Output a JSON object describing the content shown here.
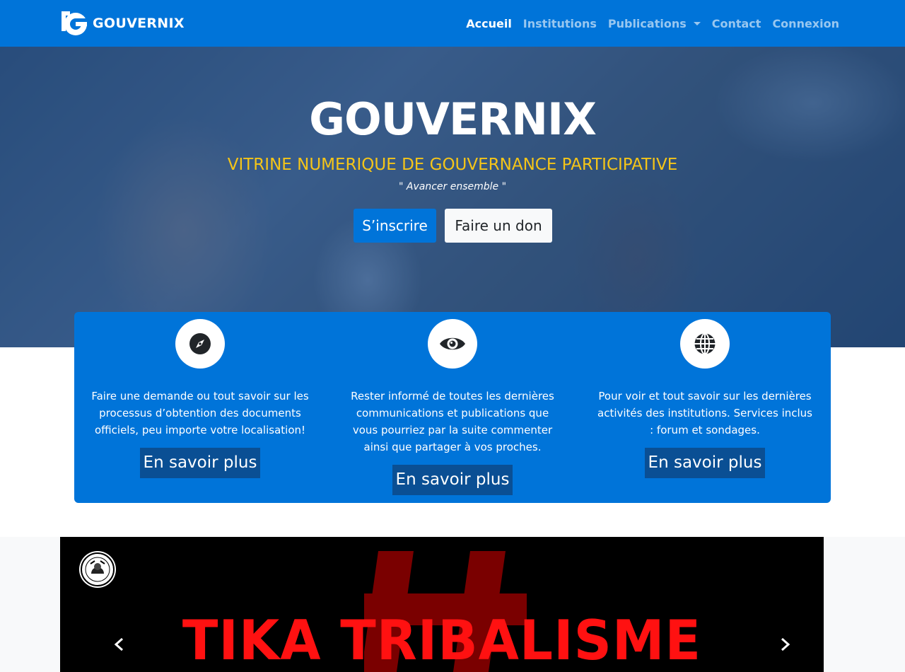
{
  "navbar": {
    "brand": "GOUVERNIX",
    "links": [
      {
        "label": "Accueil",
        "active": true
      },
      {
        "label": "Institutions"
      },
      {
        "label": "Publications",
        "dropdown": true
      },
      {
        "label": "Contact"
      },
      {
        "label": "Connexion"
      }
    ],
    "color": "#0074d9"
  },
  "hero": {
    "title": "GOUVERNIX",
    "subtitle": "VITRINE NUMERIQUE DE GOUVERNANCE PARTICIPATIVE",
    "quote": "\" Avancer ensemble \"",
    "primary_button": "S’inscrire",
    "secondary_button": "Faire un don",
    "subtitle_color": "#f5c518"
  },
  "features": [
    {
      "icon": "compass-icon",
      "text": "Faire une demande ou tout savoir sur les processus d’obtention des documents officiels, peu importe votre localisation!",
      "button": "En savoir plus"
    },
    {
      "icon": "eye-icon",
      "text": "Rester informé de toutes les dernières communications et publications que vous pourriez par la suite commenter ainsi que partager à vos proches.",
      "button": "En savoir plus"
    },
    {
      "icon": "globe-icon",
      "text": "Pour voir et tout savoir sur les dernières activités des institutions. Services inclus : forum et sondages.",
      "button": "En savoir plus"
    }
  ],
  "carousel": {
    "slide_text": "TIKA TRIBALISME",
    "text_color": "#ff1111"
  }
}
